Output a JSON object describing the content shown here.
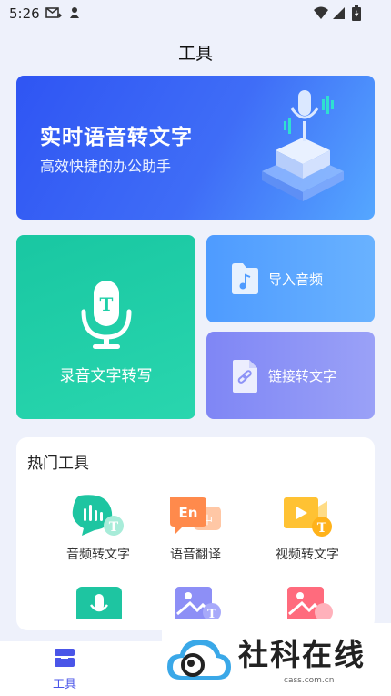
{
  "status_bar": {
    "time": "5:26"
  },
  "header": {
    "title": "工具"
  },
  "banner": {
    "title": "实时语音转文字",
    "subtitle": "高效快捷的办公助手"
  },
  "features": {
    "record": {
      "label": "录音文字转写"
    },
    "import_audio": {
      "label": "导入音频"
    },
    "link_to_text": {
      "label": "链接转文字"
    }
  },
  "hot_tools": {
    "title": "热门工具",
    "items": [
      {
        "label": "音频转文字",
        "icon": "audio-bars-icon"
      },
      {
        "label": "语音翻译",
        "icon": "translate-en-zh-icon"
      },
      {
        "label": "视频转文字",
        "icon": "video-play-icon"
      },
      {
        "label": "",
        "icon": "mic-green-icon"
      },
      {
        "label": "",
        "icon": "image-to-text-icon"
      },
      {
        "label": "",
        "icon": "image-red-icon"
      }
    ]
  },
  "bottom_nav": {
    "tools_label": "工具"
  },
  "watermark": {
    "text": "社科在线",
    "url": "cass.com.cn"
  },
  "colors": {
    "accent": "#4a55e8",
    "green": "#1fcfa7",
    "blue": "#5aa6ff",
    "purple": "#8d93f6"
  }
}
